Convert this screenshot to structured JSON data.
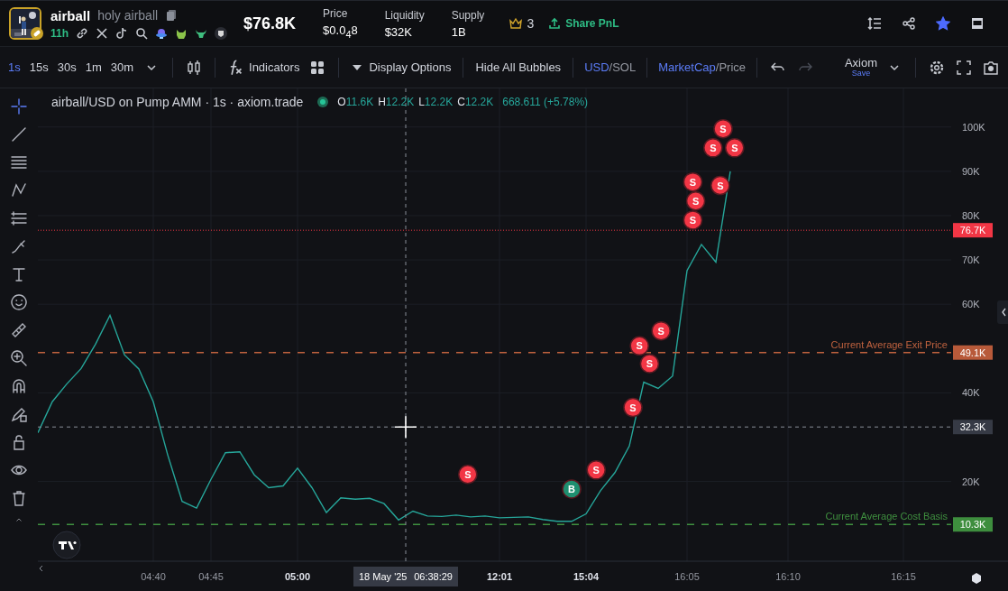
{
  "header": {
    "token": {
      "symbol": "airball",
      "name": "holy airball",
      "age": "11h"
    },
    "market_cap": "$76.8K",
    "stats": [
      {
        "label": "Price",
        "value": "$0.0$_{4}$8"
      },
      {
        "label": "Liquidity",
        "value": "$32K"
      },
      {
        "label": "Supply",
        "value": "1B"
      }
    ],
    "top_holders": "3",
    "share_button": "Share PnL",
    "starred": true
  },
  "toolbar": {
    "timeframes": [
      {
        "label": "1s",
        "selected": true
      },
      {
        "label": "15s",
        "selected": false
      },
      {
        "label": "30s",
        "selected": false
      },
      {
        "label": "1m",
        "selected": false
      },
      {
        "label": "30m",
        "selected": false
      }
    ],
    "indicators_button": "Indicators",
    "display_options": "Display Options",
    "bubbles_button": "Hide All Bubbles",
    "currency_toggle": {
      "separator": "/",
      "options": [
        {
          "label": "USD",
          "selected": true
        },
        {
          "label": "SOL",
          "selected": false
        }
      ]
    },
    "metric_toggle": {
      "separator": "/",
      "options": [
        {
          "label": "MarketCap",
          "selected": true
        },
        {
          "label": "Price",
          "selected": false
        }
      ]
    },
    "history": [
      {
        "kind": "undo",
        "disabled": false
      },
      {
        "kind": "redo",
        "disabled": true
      }
    ],
    "layout": {
      "name": "Axiom",
      "action": "Save"
    }
  },
  "chart": {
    "legend": {
      "title": "airball/USD on Pump AMM · 1s · axiom.trade",
      "ohlc": [
        {
          "key": "O",
          "value": "11.6K"
        },
        {
          "key": "H",
          "value": "12.2K"
        },
        {
          "key": "L",
          "value": "12.2K"
        },
        {
          "key": "C",
          "value": "12.2K"
        }
      ],
      "change": "668.611 (+5.78%)"
    },
    "chart_data": {
      "type": "line",
      "grid": true,
      "ylim": [
        2000,
        108300
      ],
      "yticks": [
        {
          "value": 20000,
          "label": "20K"
        },
        {
          "value": 40000,
          "label": "40K"
        },
        {
          "value": 60000,
          "label": "60K"
        },
        {
          "value": 70000,
          "label": "70K"
        },
        {
          "value": 80000,
          "label": "80K"
        },
        {
          "value": 90000,
          "label": "90K"
        },
        {
          "value": 100000,
          "label": "100K"
        }
      ],
      "categories": [
        null,
        null,
        null,
        null,
        null,
        null,
        null,
        null,
        "04:40",
        null,
        null,
        null,
        "04:45",
        null,
        null,
        null,
        null,
        null,
        "05:00",
        null,
        null,
        null,
        null,
        null,
        null,
        null,
        null,
        null,
        null,
        null,
        null,
        null,
        "12:01",
        null,
        null,
        null,
        null,
        null,
        "15:04",
        null,
        null,
        null,
        null,
        null,
        null,
        "16:05",
        null,
        null,
        null,
        null,
        null,
        null,
        "16:10",
        null,
        null,
        null,
        null,
        null,
        null,
        null,
        "16:15",
        null,
        null,
        null
      ],
      "series": [
        {
          "color": "#26a69a",
          "values": [
            31000,
            38000,
            42000,
            45500,
            51000,
            57500,
            48600,
            45400,
            38000,
            26000,
            15500,
            14000,
            20500,
            26500,
            26700,
            21500,
            18600,
            19000,
            23000,
            18600,
            13000,
            16300,
            16000,
            16200,
            15000,
            11300,
            13300,
            12200,
            12100,
            12400,
            12000,
            12200,
            11800,
            11900,
            12000,
            11400,
            11000,
            11000,
            12700,
            17900,
            22000,
            28000,
            42400,
            41000,
            43800,
            67600,
            73500,
            69500,
            90000,
            null,
            null,
            null,
            null,
            null,
            null,
            null,
            null,
            null,
            null,
            null,
            null,
            null,
            null,
            null
          ]
        }
      ],
      "ref_lines": [
        {
          "axis": "y",
          "value": 76700,
          "color": "#f23645"
        },
        {
          "axis": "y",
          "value": 49100,
          "label": "Current Average Exit Price",
          "color": "#c0623f"
        },
        {
          "axis": "y",
          "value": 32300,
          "color": "#8a8f99"
        },
        {
          "axis": "y",
          "value": 10300,
          "label": "Current Average Cost Basis",
          "color": "#3f8f3f"
        }
      ],
      "annotations": [
        {
          "y": 99600,
          "text": "S"
        },
        {
          "y": 95300,
          "text": "S"
        },
        {
          "y": 95300,
          "text": "S"
        },
        {
          "y": 87600,
          "text": "S"
        },
        {
          "y": 86800,
          "text": "S"
        },
        {
          "y": 83300,
          "text": "S"
        },
        {
          "y": 79000,
          "text": "S"
        },
        {
          "y": 54000,
          "text": "S"
        },
        {
          "y": 50600,
          "text": "S"
        },
        {
          "y": 46600,
          "text": "S"
        },
        {
          "y": 36700,
          "text": "S"
        },
        {
          "y": 22600,
          "text": "S"
        },
        {
          "y": 21600,
          "text": "S"
        },
        {
          "y": 18300,
          "text": "B"
        }
      ]
    },
    "time_label_styles": [
      {
        "major": false
      },
      {
        "major": false
      },
      {
        "major": true
      },
      {
        "major": true
      },
      {
        "major": true
      },
      {
        "major": false
      },
      {
        "major": false
      },
      {
        "major": false
      }
    ],
    "price_tags": [
      {
        "kind": "last",
        "text": "76.7K",
        "color": "#f23645"
      },
      {
        "kind": "level",
        "text": "49.1K",
        "color": "#b85a3a"
      },
      {
        "kind": "crosshair",
        "text": "32.3K",
        "color": "#363a45"
      },
      {
        "kind": "level",
        "text": "10.3K",
        "color": "#3e8e3e"
      }
    ],
    "crosshair": {
      "date": "18 May '25",
      "time": "06:38:29"
    },
    "trade_markers": [
      {
        "color": "#f23645"
      },
      {
        "color": "#f23645"
      },
      {
        "color": "#f23645"
      },
      {
        "color": "#f23645"
      },
      {
        "color": "#f23645"
      },
      {
        "color": "#f23645"
      },
      {
        "color": "#f23645"
      },
      {
        "color": "#f23645"
      },
      {
        "color": "#f23645"
      },
      {
        "color": "#f23645"
      },
      {
        "color": "#f23645"
      },
      {
        "color": "#f23645"
      },
      {
        "color": "#f23645"
      },
      {
        "color": "#1f8f70"
      }
    ]
  }
}
